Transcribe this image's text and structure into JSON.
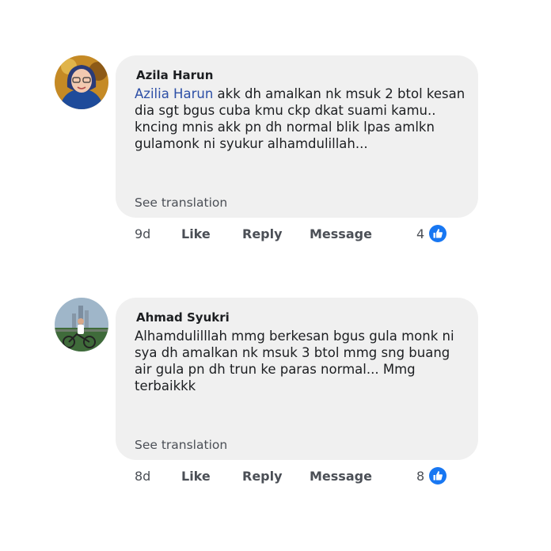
{
  "comments": [
    {
      "author": "Azila Harun",
      "mention": "Azilia Harun",
      "text": " akk dh amalkan nk msuk 2 btol kesan dia sgt bgus cuba kmu ckp dkat suami kamu.. kncing mnis akk pn dh normal blik lpas amlkn gulamonk ni syukur alhamdulillah...",
      "see_translation": "See translation",
      "time": "9d",
      "like_label": "Like",
      "reply_label": "Reply",
      "message_label": "Message",
      "reactions": "4",
      "avatar_icon": "user-avatar-photo"
    },
    {
      "author": "Ahmad Syukri",
      "text": "Alhamdulilllah mmg berkesan bgus gula monk ni sya dh amalkan nk msuk 3 btol mmg sng buang air gula pn dh trun ke paras normal... Mmg terbaikkk",
      "see_translation": "See translation",
      "time": "8d",
      "like_label": "Like",
      "reply_label": "Reply",
      "message_label": "Message",
      "reactions": "8",
      "avatar_icon": "user-avatar-photo"
    }
  ],
  "colors": {
    "bubble": "#f0f0f0",
    "mention": "#2d4fa6",
    "like_blue": "#1877f2"
  }
}
